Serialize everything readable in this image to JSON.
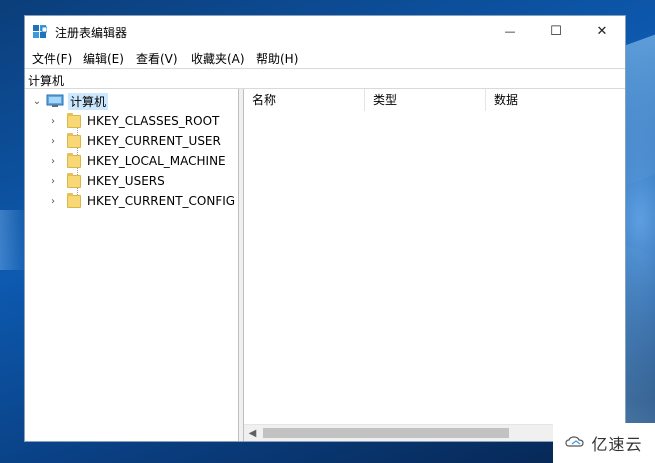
{
  "window": {
    "title": "注册表编辑器",
    "minimize_glyph": "—",
    "maximize_glyph": "☐",
    "close_glyph": "✕"
  },
  "menu": [
    {
      "label": "文件(F)"
    },
    {
      "label": "编辑(E)"
    },
    {
      "label": "查看(V)"
    },
    {
      "label": "收藏夹(A)"
    },
    {
      "label": "帮助(H)"
    }
  ],
  "address": {
    "path": "计算机"
  },
  "tree": {
    "root": {
      "label": "计算机",
      "icon": "computer-icon",
      "expanded": true
    },
    "children": [
      {
        "label": "HKEY_CLASSES_ROOT",
        "icon": "folder-icon"
      },
      {
        "label": "HKEY_CURRENT_USER",
        "icon": "folder-icon"
      },
      {
        "label": "HKEY_LOCAL_MACHINE",
        "icon": "folder-icon"
      },
      {
        "label": "HKEY_USERS",
        "icon": "folder-icon"
      },
      {
        "label": "HKEY_CURRENT_CONFIG",
        "icon": "folder-icon"
      }
    ]
  },
  "list": {
    "columns": [
      {
        "label": "名称"
      },
      {
        "label": "类型"
      },
      {
        "label": "数据"
      }
    ]
  },
  "watermark": {
    "text": "亿速云"
  },
  "colors": {
    "selection": "#cce8ff",
    "folder": "#f8d775",
    "desktop": "#0d5ab0"
  }
}
